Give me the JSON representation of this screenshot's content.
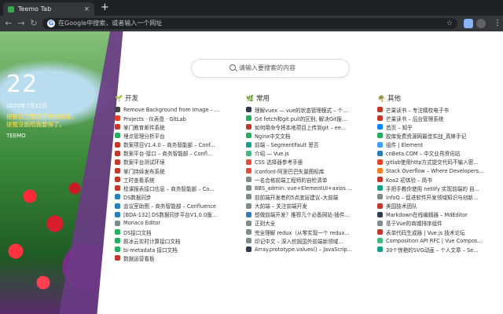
{
  "browser": {
    "tab_title": "Teemo Tab",
    "tab_close": "×",
    "new_tab": "+",
    "back": "←",
    "forward": "→",
    "reload": "↻",
    "omnibox_placeholder": "在Google中搜索，或者输入一个网址",
    "star": "☆",
    "menu": "⋮",
    "colors": {
      "tabbar": "#202124",
      "toolbar": "#35363a"
    }
  },
  "hero": {
    "day": "22",
    "date": "2020年7月22日",
    "quote": "提醒自己要活了也是提醒，提醒没能陪我要得了。",
    "author": "TEEMO"
  },
  "search": {
    "placeholder": "请输入要搜索的内容"
  },
  "columns": [
    {
      "title": "开发",
      "icon": "sprout-icon",
      "items": [
        {
          "label": "Remove Background from Image – ...",
          "color": "#444"
        },
        {
          "label": "Projects · 仪表盘 · GitLab",
          "color": "#e24329"
        },
        {
          "label": "掌门教育邮件系统",
          "color": "#c0392b"
        },
        {
          "label": "埋点管理分析平台",
          "color": "#27ae60"
        },
        {
          "label": "数案项目V1.4.0 – 商务智能部 – Conf...",
          "color": "#c0392b"
        },
        {
          "label": "数案平台-接口 – 商务智能部 – Confl...",
          "color": "#c0392b"
        },
        {
          "label": "数案平台测试环境",
          "color": "#c0392b"
        },
        {
          "label": "掌门持续发布系统",
          "color": "#c0392b"
        },
        {
          "label": "工时查看系统",
          "color": "#c0392b"
        },
        {
          "label": "校课报表接口信息 – 商务智能部 – Co...",
          "color": "#c0392b"
        },
        {
          "label": "DS数据同步",
          "color": "#2980b9"
        },
        {
          "label": "会议室助图 – 商务智能部 – Confluence",
          "color": "#2980b9"
        },
        {
          "label": "[BDA-132] DS数据同步平台V1.0.0版...",
          "color": "#2980b9"
        },
        {
          "label": "Monaco Editor",
          "color": "#7f8c8d"
        },
        {
          "label": "DS接口文档",
          "color": "#27ae60"
        },
        {
          "label": "题冰云实时计算接口文档",
          "color": "#27ae60"
        },
        {
          "label": "bi-metadata 接口文档",
          "color": "#27ae60"
        },
        {
          "label": "数据运营看板",
          "color": "#c0392b"
        }
      ]
    },
    {
      "title": "常用",
      "icon": "leaf-icon",
      "items": [
        {
          "label": "理解vuex — vue的状态管理模式 – 个...",
          "color": "#2c3e50"
        },
        {
          "label": "Git fetch和git pull的区别, 解决Git报...",
          "color": "#27ae60"
        },
        {
          "label": "如何用命令将本地项目上传到git – ee...",
          "color": "#c0392b"
        },
        {
          "label": "Nginx中文文档",
          "color": "#27ae60"
        },
        {
          "label": "前端 – SegmentFault 思否",
          "color": "#16a085"
        },
        {
          "label": "介绍 — Vue.js",
          "color": "#42b883"
        },
        {
          "label": "CSS 选择器参考手册",
          "color": "#e74c3c"
        },
        {
          "label": "iconfont-阿里巴巴矢量图标库",
          "color": "#e74c3c"
        },
        {
          "label": "一名合格前端工程师的自检清单",
          "color": "#7f8c8d"
        },
        {
          "label": "BBS_admin: vue+ElementUI+axios ...",
          "color": "#7f8c8d"
        },
        {
          "label": "前前端开发者的5点底层建议–大前端",
          "color": "#7f8c8d"
        },
        {
          "label": "大前端 – 关注前端开发",
          "color": "#7f8c8d"
        },
        {
          "label": "想做前端开发？推荐几个必备网站-插件...",
          "color": "#2980b9"
        },
        {
          "label": "正则大全",
          "color": "#7f8c8d"
        },
        {
          "label": "完全理解 redux（从零实现一个 redux...",
          "color": "#7f8c8d"
        },
        {
          "label": "印记中文 – 深入挖掘国外前端新领域...",
          "color": "#7f8c8d"
        },
        {
          "label": "Array.prototype.values() – JavaScrip...",
          "color": "#2c3e50"
        }
      ]
    },
    {
      "title": "其他",
      "icon": "palm-icon",
      "items": [
        {
          "label": "芒果读书 – 专注精校电子书",
          "color": "#c0392b"
        },
        {
          "label": "芒果读书 – 后台管理系统",
          "color": "#c0392b"
        },
        {
          "label": "首页 – 知乎",
          "color": "#0084ff"
        },
        {
          "label": "胶库免费资源网最佳实战_真锋手记",
          "color": "#27ae60"
        },
        {
          "label": "组件 | Element",
          "color": "#409eff"
        },
        {
          "label": "cnBeta.COM – 中文业界资讯站",
          "color": "#2980b9"
        },
        {
          "label": "gitlab使用http方式提交代码不输入密...",
          "color": "#e24329"
        },
        {
          "label": "Stack Overflow – Where Developers...",
          "color": "#f48024"
        },
        {
          "label": "Koa2 初体验 – 简书",
          "color": "#c0392b"
        },
        {
          "label": "手把手教你使用 netlify 实现前端的 自...",
          "color": "#16a085"
        },
        {
          "label": "InfoQ – 促进软件开发领域知识与创新...",
          "color": "#7f8c8d"
        },
        {
          "label": "美国技术团队",
          "color": "#c0392b"
        },
        {
          "label": "Markdown在线编辑器 – MdEditor",
          "color": "#2c3e50"
        },
        {
          "label": "基于Vue的商城排序组件",
          "color": "#7f8c8d"
        },
        {
          "label": "表单代码生成器 | Vue.js 技术论坛",
          "color": "#c0392b"
        },
        {
          "label": "Composition API RFC | Vue Compos...",
          "color": "#42b883"
        },
        {
          "label": "30个惊艳的SVG动画 – 个人文章 – Se...",
          "color": "#16a085"
        }
      ]
    }
  ]
}
